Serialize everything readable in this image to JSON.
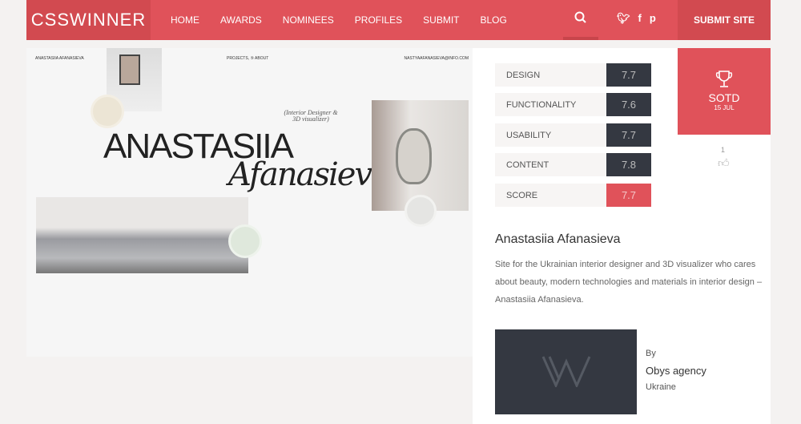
{
  "nav": {
    "logo": "CSSWINNER",
    "items": [
      "HOME",
      "AWARDS",
      "NOMINEES",
      "PROFILES",
      "SUBMIT",
      "BLOG"
    ],
    "submit": "SUBMIT SITE"
  },
  "preview": {
    "brand": "ANASTASIIA AFANASIEVA",
    "menu": "PROJECTS, ⑤   ABOUT",
    "email": "NASTYAAFANASIEVA@INFO.COM",
    "title1": "ANASTASIIA",
    "title2": "Afanasieva",
    "subtitle": "(Interior Designer & 3D visualizer)"
  },
  "scores": [
    {
      "label": "DESIGN",
      "value": "7.7"
    },
    {
      "label": "FUNCTIONALITY",
      "value": "7.6"
    },
    {
      "label": "USABILITY",
      "value": "7.7"
    },
    {
      "label": "CONTENT",
      "value": "7.8"
    },
    {
      "label": "SCORE",
      "value": "7.7"
    }
  ],
  "award": {
    "title": "SOTD",
    "date": "15 JUL",
    "likes": "1"
  },
  "site": {
    "name": "Anastasiia Afanasieva",
    "description": "Site for the Ukrainian interior designer and 3D visualizer who cares about beauty, modern technologies and materials in interior design – Anastasiia Afanasieva."
  },
  "author": {
    "by": "By",
    "name": "Obys agency",
    "country": "Ukraine"
  },
  "colors": {
    "accent": "#e0525a",
    "dark": "#343841"
  }
}
